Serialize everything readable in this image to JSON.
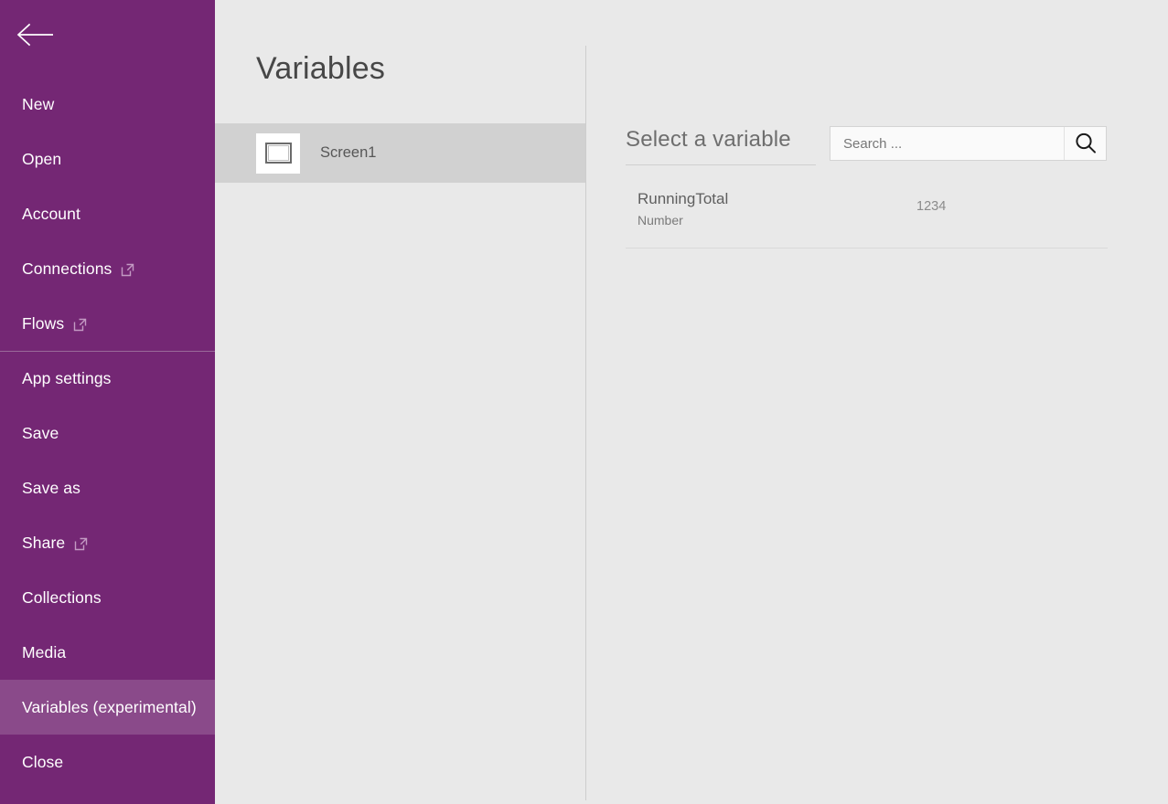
{
  "colors": {
    "sidebar_bg": "#742774",
    "sidebar_selected_bg": "#8a4a8a",
    "panel_bg": "#e9e9e9",
    "row_selected_bg": "#d1d1d1",
    "title_text": "#474747"
  },
  "sidebar": {
    "back_icon": "back-arrow-icon",
    "items": [
      {
        "label": "New",
        "external": false,
        "selected": false,
        "divider_above": false
      },
      {
        "label": "Open",
        "external": false,
        "selected": false,
        "divider_above": false
      },
      {
        "label": "Account",
        "external": false,
        "selected": false,
        "divider_above": false
      },
      {
        "label": "Connections",
        "external": true,
        "selected": false,
        "divider_above": false
      },
      {
        "label": "Flows",
        "external": true,
        "selected": false,
        "divider_above": false
      },
      {
        "label": "App settings",
        "external": false,
        "selected": false,
        "divider_above": true
      },
      {
        "label": "Save",
        "external": false,
        "selected": false,
        "divider_above": false
      },
      {
        "label": "Save as",
        "external": false,
        "selected": false,
        "divider_above": false
      },
      {
        "label": "Share",
        "external": true,
        "selected": false,
        "divider_above": false
      },
      {
        "label": "Collections",
        "external": false,
        "selected": false,
        "divider_above": false
      },
      {
        "label": "Media",
        "external": false,
        "selected": false,
        "divider_above": false
      },
      {
        "label": "Variables (experimental)",
        "external": false,
        "selected": true,
        "divider_above": false
      },
      {
        "label": "Close",
        "external": false,
        "selected": false,
        "divider_above": false
      }
    ]
  },
  "mid_panel": {
    "title": "Variables",
    "screen_item": {
      "label": "Screen1",
      "icon": "screen-icon"
    }
  },
  "right_panel": {
    "heading": "Select a variable",
    "search": {
      "placeholder": "Search ...",
      "value": "",
      "icon": "search-icon"
    },
    "variables": [
      {
        "name": "RunningTotal",
        "type": "Number",
        "value": "1234"
      }
    ]
  }
}
